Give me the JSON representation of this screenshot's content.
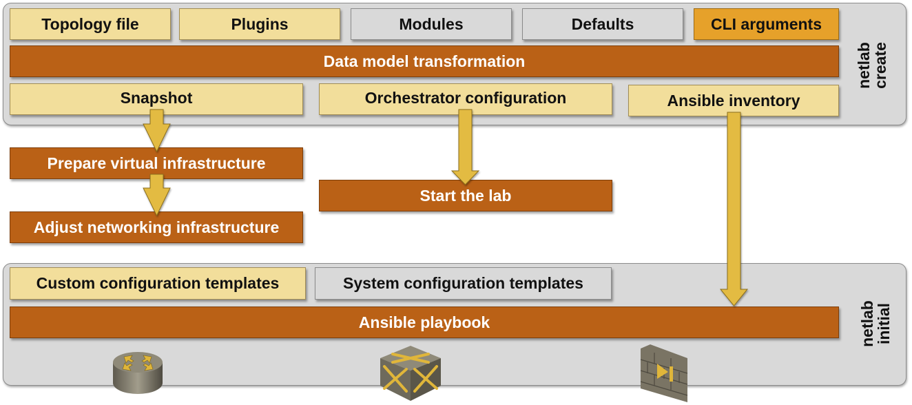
{
  "create_stage": {
    "label_line1": "netlab",
    "label_line2": "create",
    "inputs": [
      {
        "label": "Topology file",
        "kind": "user"
      },
      {
        "label": "Plugins",
        "kind": "user"
      },
      {
        "label": "Modules",
        "kind": "system"
      },
      {
        "label": "Defaults",
        "kind": "system"
      },
      {
        "label": "CLI arguments",
        "kind": "cli"
      }
    ],
    "transform": "Data model transformation",
    "outputs": [
      {
        "label": "Snapshot"
      },
      {
        "label": "Orchestrator configuration"
      },
      {
        "label": "Ansible inventory"
      }
    ]
  },
  "up_steps": {
    "prepare": "Prepare virtual infrastructure",
    "adjust": "Adjust networking infrastructure",
    "start": "Start the lab"
  },
  "initial_stage": {
    "label_line1": "netlab",
    "label_line2": "initial",
    "templates": [
      {
        "label": "Custom configuration templates",
        "kind": "user"
      },
      {
        "label": "System configuration templates",
        "kind": "system"
      }
    ],
    "playbook": "Ansible playbook",
    "devices": [
      "router-icon",
      "switch-icon",
      "firewall-icon"
    ]
  },
  "colors": {
    "user_input": "#f2de9b",
    "system_input": "#d9d9d9",
    "cli_input": "#e6a12a",
    "process": "#ba6116",
    "arrow": "#e3bb42"
  }
}
